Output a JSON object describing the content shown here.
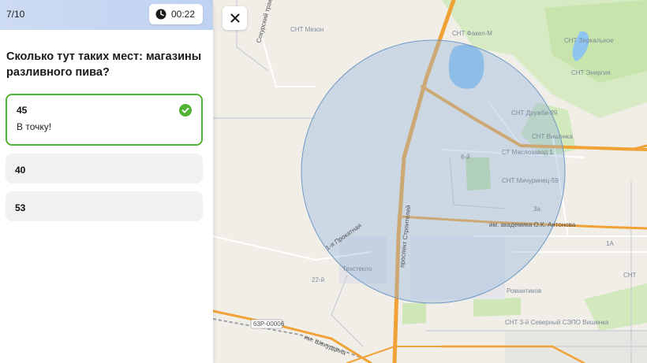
{
  "quiz": {
    "progress": "7/10",
    "timer": "00:22",
    "question": "Сколько тут таких мест: магазины разливного пива?",
    "options": [
      {
        "value": "45",
        "feedback": "В точку!",
        "state": "correct"
      },
      {
        "value": "40"
      },
      {
        "value": "53"
      }
    ]
  },
  "map": {
    "labels": {
      "mezon": "СНТ Мезон",
      "fakel": "СНТ Факел-М",
      "zerkalnoe": "СНТ Зеркальное",
      "energia": "СНТ Энергия",
      "druzhba": "СНТ Дружба-89",
      "vishenka": "СНТ Вишенка",
      "maslozavod": "СТ Маслозавод 1",
      "michurinets": "СНТ Мичуринец-59",
      "antonova": "им. академика О.К. Антонова",
      "prospekt": "проспект Строителей",
      "prokatnaya": "1-я Прокатная",
      "tekhsteklo": "Техстекло",
      "trakt": "Сокурский тракт",
      "romantikov": "Романтиков",
      "snt_bottom": "СНТ 3-й Северный СЭПО Вишенка",
      "snt_right": "СНТ",
      "road_code": "63Р-00006",
      "shekhurdina": "им. Шехурдина",
      "b22": "22-й",
      "b6": "6-й",
      "b3a": "3а",
      "b1a": "1А"
    },
    "colors": {
      "highway": "#f0a236",
      "circle_fill": "#8fb4d9",
      "circle_stroke": "#6f9ac6",
      "green": "#c9e6b0",
      "water": "#8ec5f0",
      "correct": "#52b436"
    }
  }
}
